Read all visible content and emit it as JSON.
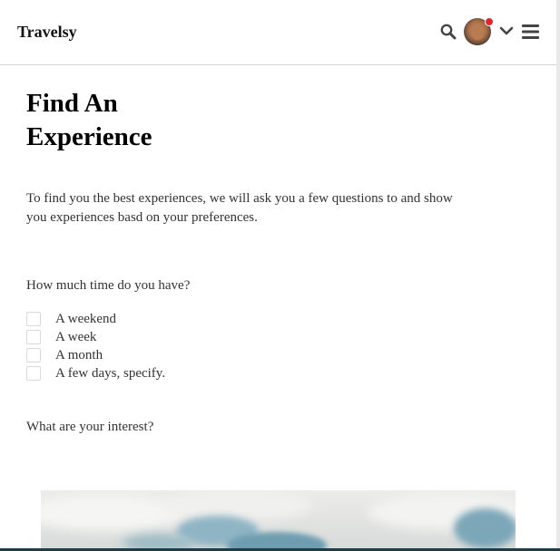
{
  "header": {
    "logo": "Travelsy",
    "icons": {
      "search": "search-icon",
      "avatar": "avatar",
      "notification": "notification-dot",
      "dropdown": "chevron-down-icon",
      "menu": "menu-icon"
    }
  },
  "main": {
    "title_line1": "Find An",
    "title_line2": "Experience",
    "intro": "To find you the best experiences, we will ask you a few questions to and show you experiences basd on your preferences.",
    "question_time": "How much time do you have?",
    "time_options": [
      {
        "label": "A weekend",
        "checked": false
      },
      {
        "label": "A week",
        "checked": false
      },
      {
        "label": "A month",
        "checked": false
      },
      {
        "label": "A few days, specify.",
        "checked": false
      }
    ],
    "question_interest": "What are your interest?"
  },
  "colors": {
    "notification": "#e0262b",
    "bottom_bar": "#1f3d46",
    "text": "#333333"
  }
}
